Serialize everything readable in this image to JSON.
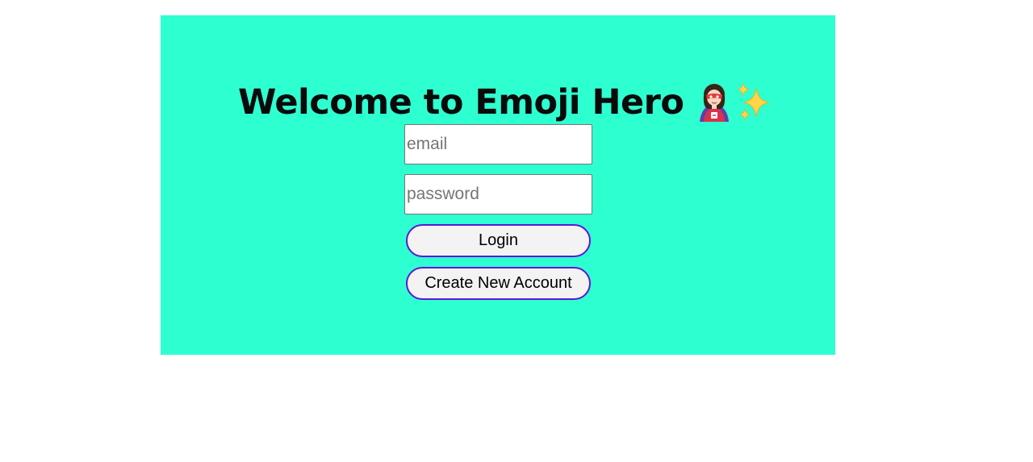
{
  "page": {
    "background_color": "#ffffff",
    "card_color": "#2effd1",
    "accent_border_color": "#5a17d6"
  },
  "header": {
    "title": "Welcome to Emoji Hero",
    "icons": [
      "superhero-woman-icon",
      "sparkles-icon"
    ]
  },
  "form": {
    "email_placeholder": "email",
    "email_value": "",
    "password_placeholder": "password",
    "password_value": "",
    "login_label": "Login",
    "create_account_label": "Create New Account"
  }
}
